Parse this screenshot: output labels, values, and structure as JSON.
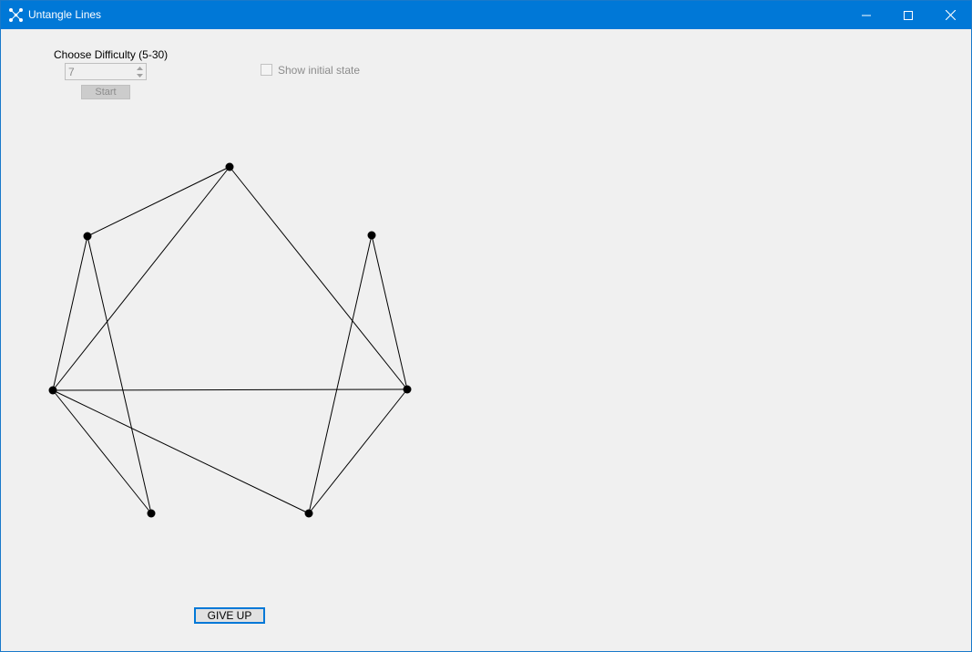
{
  "window": {
    "title": "Untangle Lines",
    "colors": {
      "titlebar": "#0078d7",
      "client": "#f0f0f0"
    },
    "icons": [
      "graph-app-icon",
      "minimize-icon",
      "maximize-icon",
      "close-icon"
    ]
  },
  "controls": {
    "difficulty_label": "Choose Difficulty (5-30)",
    "difficulty_value": "7",
    "start_label": "Start",
    "show_initial_label": "Show initial state",
    "show_initial_checked": false,
    "give_up_label": "GIVE UP"
  },
  "graph": {
    "vertex_count": 7,
    "edge_count": 11,
    "crossings_visible": true
  }
}
